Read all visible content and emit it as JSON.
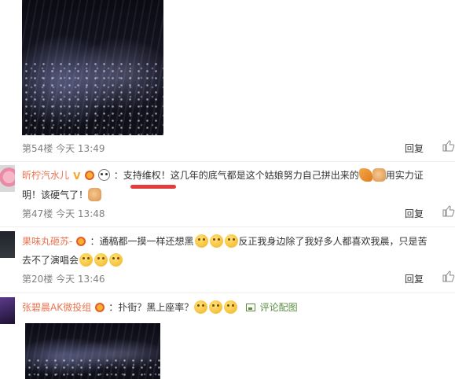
{
  "thread": {
    "reply_label": "回复",
    "comments": [
      {
        "floor": "第54楼",
        "time": "今天 13:49"
      },
      {
        "username": "昕柠汽水儿",
        "text_a": "：支持维权！这几年的底气都是这个姑娘努力自己拼出来的",
        "text_b": "用实力证",
        "text_c": "明！该硬气了！",
        "floor": "第47楼",
        "time": "今天 13:48"
      },
      {
        "username": "果味丸砸苏-",
        "text_a": "：通稿都一摸一样还想黑",
        "text_b": "反正我身边除了我好多人都喜欢我晨，只是苦",
        "text_c": "去不了演唱会",
        "floor": "第20楼",
        "time": "今天 13:46"
      },
      {
        "username": "张碧晨AK微投组",
        "text_a": "：扑街？黑上座率？",
        "picture_link": "评论配图"
      }
    ]
  },
  "icons": {
    "like": "thumbs-up-icon",
    "emoji": "laughing-crying-emoji-icon",
    "vip": "vip-badge-icon",
    "verified": "v-verified-icon"
  },
  "colors": {
    "username": "#eb7350",
    "meta": "#808080",
    "highlight": "#e53b3b",
    "link_green": "#5a8e3f"
  }
}
